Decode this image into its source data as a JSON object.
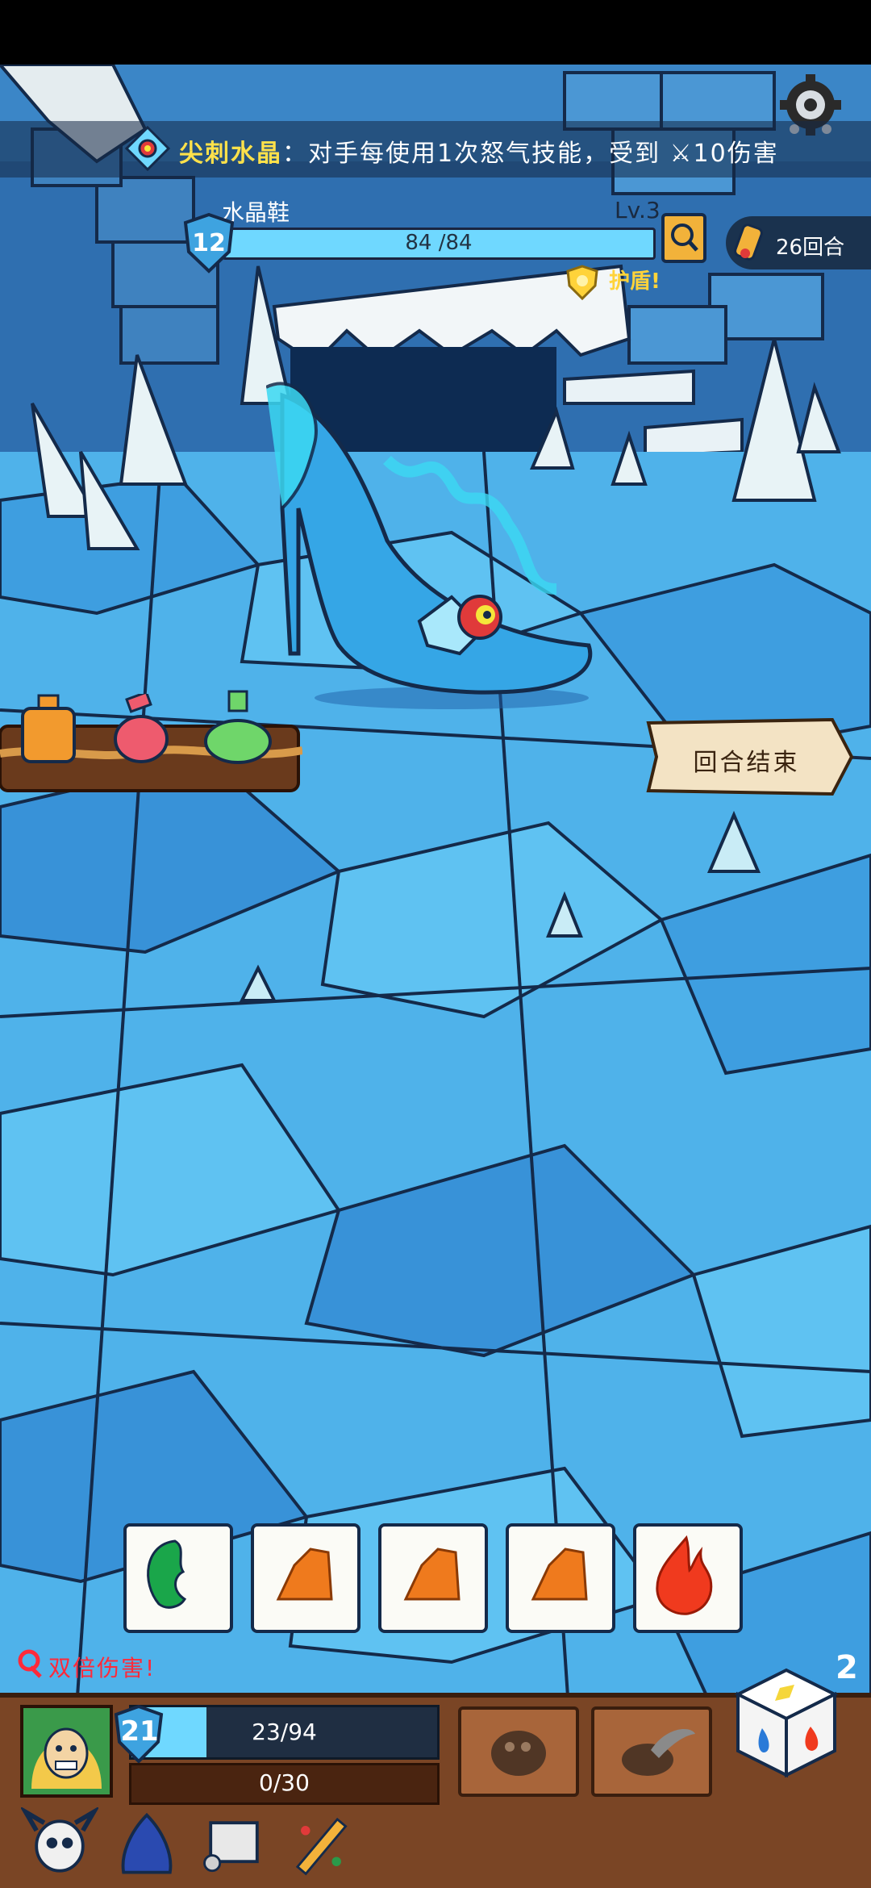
{
  "buff": {
    "name": "尖刺水晶",
    "desc": "：对手每使用1次怒气技能，受到",
    "damage": "10伤害"
  },
  "enemy": {
    "name": "水晶鞋",
    "level": "Lv.3",
    "shield_value": "12",
    "hp_text": "84 /84",
    "hp_fraction": 1.0,
    "status": "护盾!"
  },
  "round": {
    "text": "26回合"
  },
  "end_turn": {
    "label": "回合结束"
  },
  "dice": {
    "count": "2",
    "slots": [
      {
        "icon": "green-leaf-icon",
        "color": "#1aa64a"
      },
      {
        "icon": "orange-rock-icon",
        "color": "#ef7a1d"
      },
      {
        "icon": "orange-rock-icon",
        "color": "#ef7a1d"
      },
      {
        "icon": "orange-rock-icon",
        "color": "#ef7a1d"
      },
      {
        "icon": "fire-icon",
        "color": "#f03a1e"
      }
    ]
  },
  "player": {
    "shield_value": "21",
    "hp_text": "23/94",
    "hp_fraction": 0.245,
    "mp_text": "0/30",
    "bonus_text": "双倍伤害!"
  },
  "potions": [
    {
      "icon": "orange-potion-icon",
      "color": "#f29a2e"
    },
    {
      "icon": "red-potion-icon",
      "color": "#ee5b6e"
    },
    {
      "icon": "green-potion-icon",
      "color": "#6fd66a"
    }
  ],
  "nav": [
    {
      "icon": "skull-horns-icon"
    },
    {
      "icon": "blue-bag-icon"
    },
    {
      "icon": "scroll-icon"
    },
    {
      "icon": "magic-wand-icon"
    }
  ],
  "colors": {
    "ice_light": "#7fd4f3",
    "ice_mid": "#3ea3e0",
    "ice_dark": "#1f5fa8",
    "hp_blue": "#6fd8ff",
    "panel_brown": "#7a4525"
  }
}
